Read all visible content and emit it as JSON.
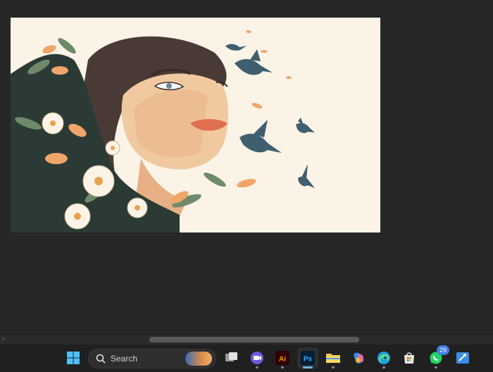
{
  "canvas": {
    "artwork_subject": "Illustration of a woman's face surrounded by flowers with birds"
  },
  "taskbar": {
    "search_label": "Search",
    "apps": [
      {
        "name": "windows-start-icon"
      },
      {
        "name": "task-view-icon"
      },
      {
        "name": "teams-meet-icon"
      },
      {
        "name": "illustrator-icon",
        "text": "Ai"
      },
      {
        "name": "photoshop-icon",
        "text": "Ps"
      },
      {
        "name": "file-explorer-icon"
      },
      {
        "name": "copilot-icon"
      },
      {
        "name": "edge-icon"
      },
      {
        "name": "store-icon"
      },
      {
        "name": "whatsapp-icon",
        "badge": "29"
      },
      {
        "name": "pinned-app-icon"
      }
    ],
    "colors": {
      "taskbar_bg": "#202020",
      "active_indicator": "#6cb6f5"
    }
  }
}
